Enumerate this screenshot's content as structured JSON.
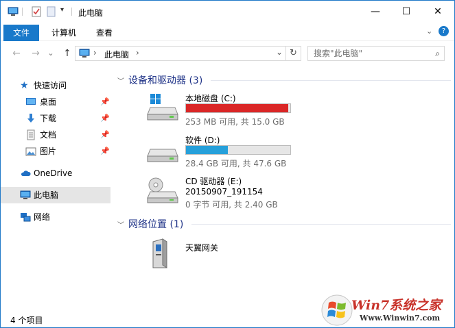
{
  "titlebar": {
    "title": "此电脑",
    "minimize": "—",
    "maximize": "☐",
    "close": "✕"
  },
  "ribbon": {
    "tabs": [
      {
        "label": "文件",
        "active": true
      },
      {
        "label": "计算机",
        "active": false
      },
      {
        "label": "查看",
        "active": false
      }
    ],
    "expand_icon": "chevron-down-icon",
    "help": "?"
  },
  "nav": {
    "back": "←",
    "forward": "→",
    "history": "⌄",
    "up": "↑",
    "address": "此电脑",
    "address_sep": "›",
    "refresh": "↻",
    "search_placeholder": "搜索\"此电脑\""
  },
  "sidebar": {
    "quick_access": "快速访问",
    "quick_items": [
      {
        "label": "桌面",
        "icon": "desktop-icon"
      },
      {
        "label": "下载",
        "icon": "download-icon"
      },
      {
        "label": "文档",
        "icon": "document-icon"
      },
      {
        "label": "图片",
        "icon": "picture-icon"
      }
    ],
    "onedrive": "OneDrive",
    "this_pc": "此电脑",
    "network": "网络"
  },
  "content": {
    "devices_group": "设备和驱动器 (3)",
    "network_group": "网络位置 (1)",
    "drives": [
      {
        "name": "本地磁盘 (C:)",
        "info": "253 MB 可用, 共 15.0 GB",
        "used_fraction": 0.983,
        "color": "#da2626",
        "icon": "windows-drive-icon"
      },
      {
        "name": "软件 (D:)",
        "info": "28.4 GB 可用, 共 47.6 GB",
        "used_fraction": 0.403,
        "color": "#26a0da",
        "icon": "hard-drive-icon"
      },
      {
        "name": "CD 驱动器 (E:)",
        "label": "20150907_191154",
        "info": "0 字节 可用, 共 2.40 GB",
        "icon": "cd-drive-icon"
      }
    ],
    "network_items": [
      {
        "name": "天翼网关",
        "icon": "network-device-icon"
      }
    ]
  },
  "status": {
    "count": "4 个项目"
  },
  "watermark": {
    "brand": "Win7系统之家",
    "url": "Www.Winwin7.com"
  }
}
